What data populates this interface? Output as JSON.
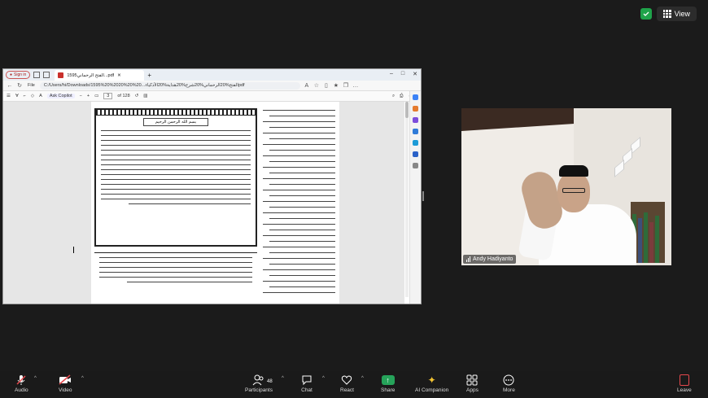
{
  "top_right": {
    "view_label": "View"
  },
  "browser": {
    "sign_in": "Sign in",
    "tab_title": "1595الفتح الرحماني...pdf",
    "address_prefix": "File",
    "url": "C:/Users/hi/Downloads/1595%20%20الفتح%20الرحماني%20شرح%20هداية%20الأذكياء...20%20%20pdf",
    "ask_copilot": "Ask Copilot",
    "page_current": "3",
    "page_total": "of 128",
    "basmala": "بسم الله الرحمن الرحيم"
  },
  "participant": {
    "name": "Andy Hadiyanto"
  },
  "toolbar": {
    "audio": "Audio",
    "video": "Video",
    "participants": "Participants",
    "participants_count": "48",
    "chat": "Chat",
    "react": "React",
    "share": "Share",
    "ai_companion": "AI Companion",
    "apps": "Apps",
    "more": "More",
    "leave": "Leave"
  },
  "colors": {
    "background": "#1b1b1b",
    "share_green": "#26a35a",
    "mute_red": "#e5484d",
    "shield_green": "#1fa34a"
  }
}
